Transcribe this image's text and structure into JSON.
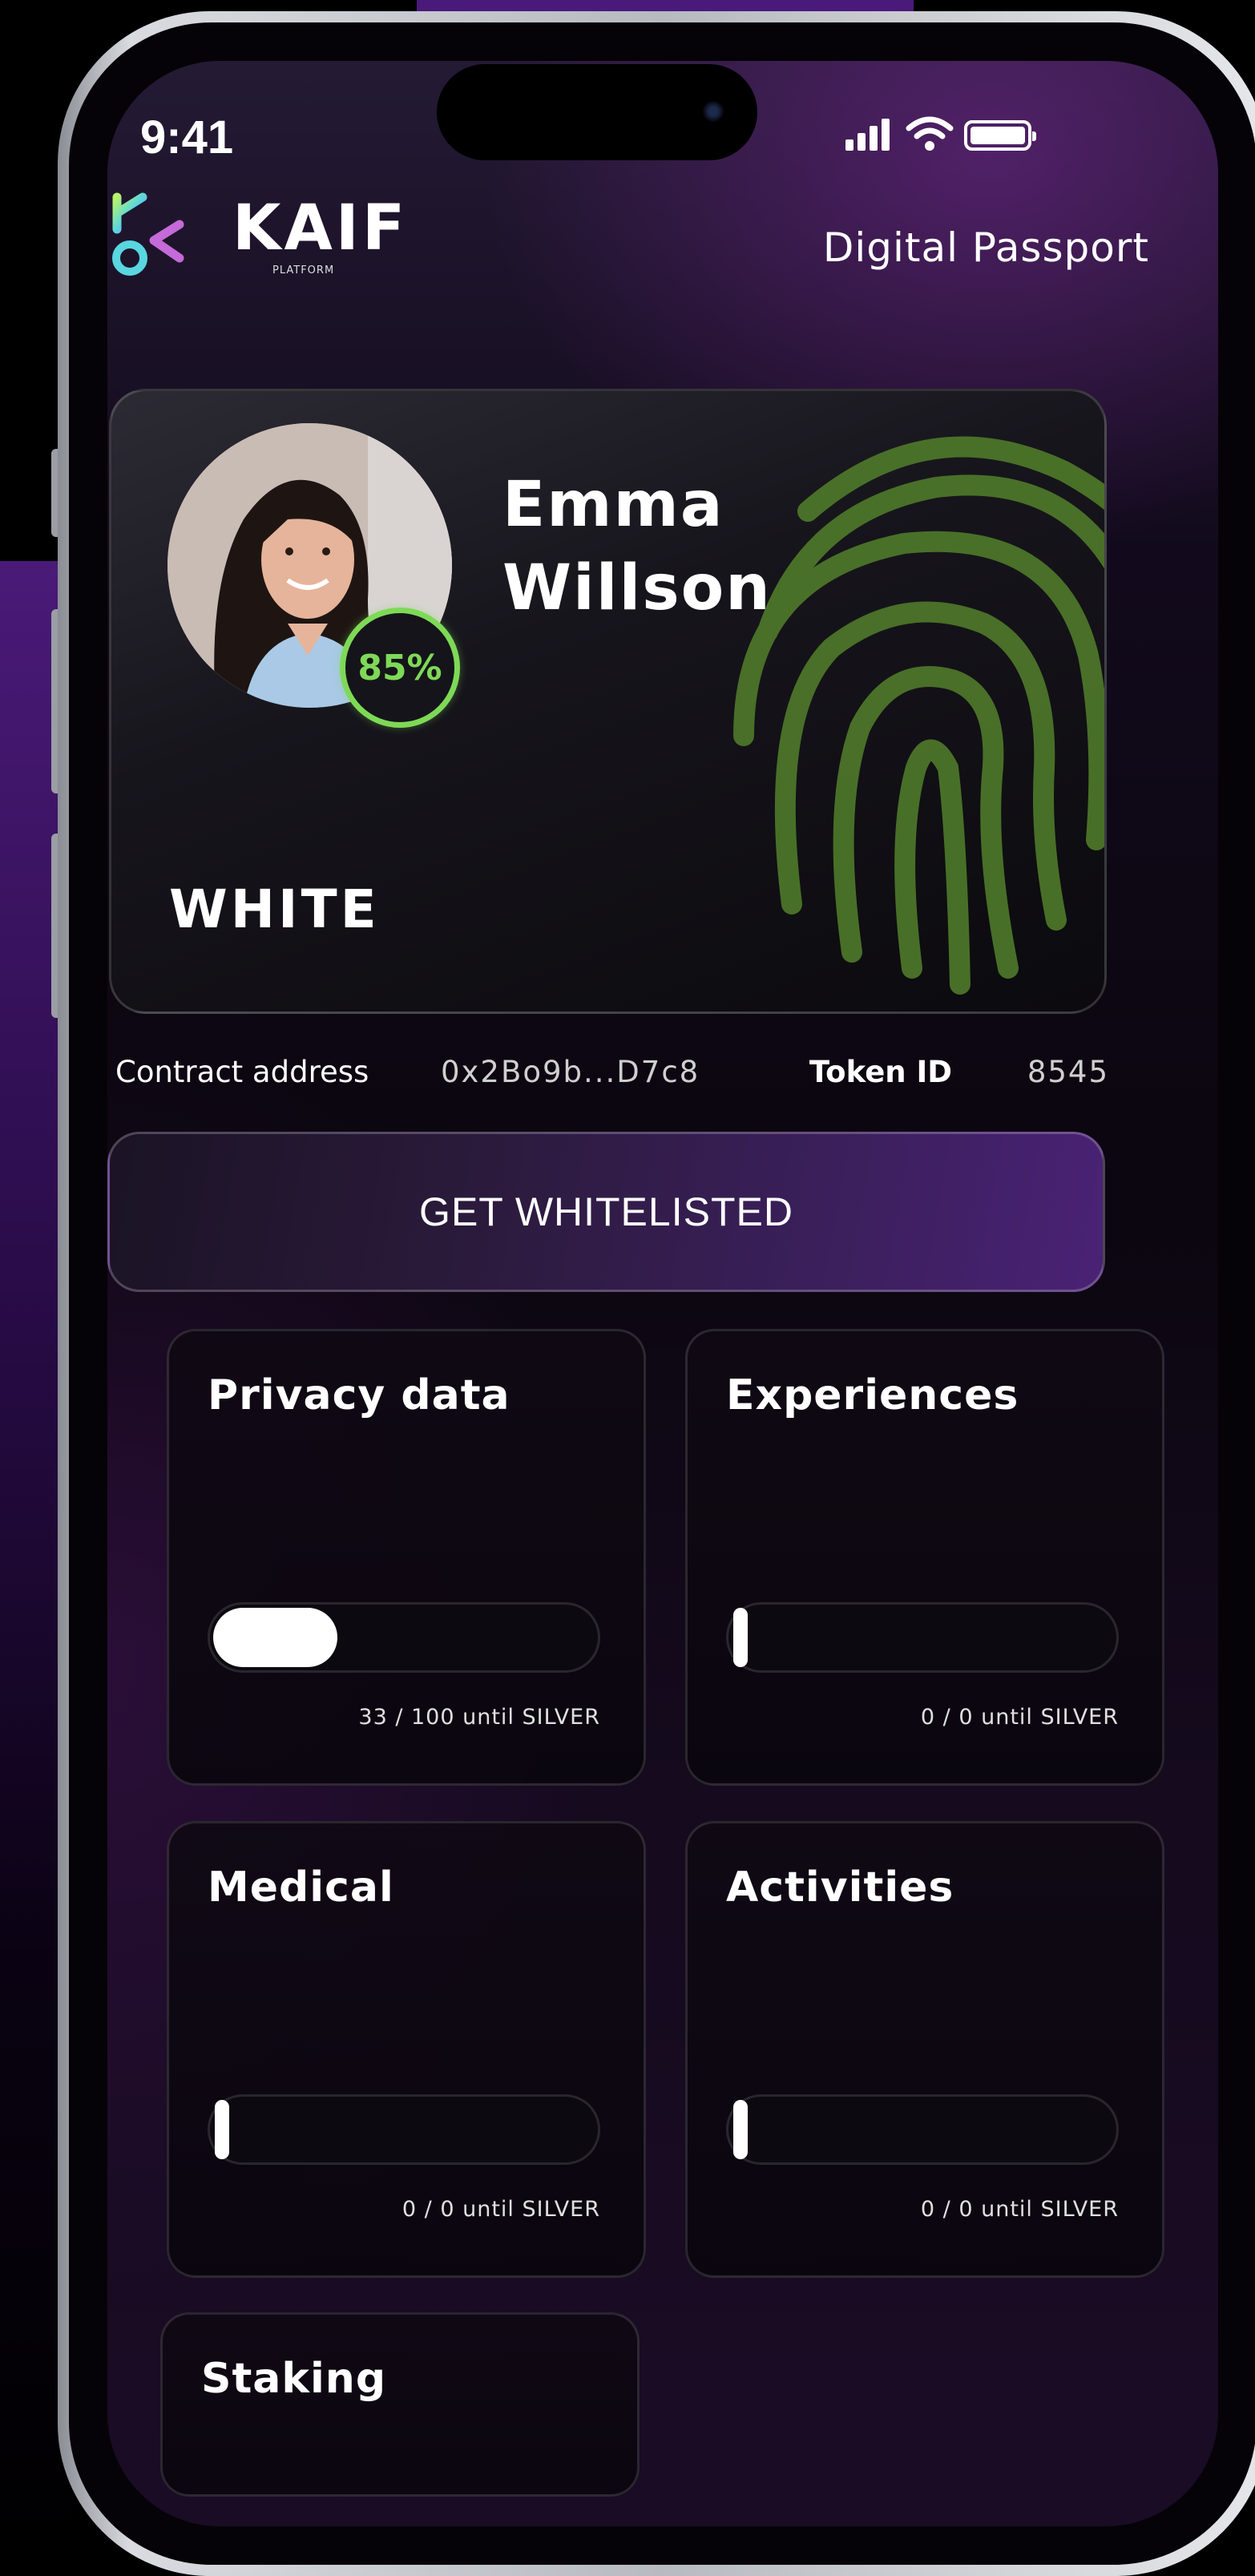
{
  "status_bar": {
    "time": "9:41"
  },
  "header": {
    "logo_text": "KAIF",
    "logo_sub": "PLATFORM",
    "title": "Digital Passport"
  },
  "passport": {
    "name_first": "Emma",
    "name_last": "Willson",
    "score": "85%",
    "score_value": 0.85,
    "tier": "WHITE",
    "contract_label": "Contract address",
    "contract_value": "0x2Bo9b...D7c8",
    "token_label": "Token ID",
    "token_value": "8545"
  },
  "cta": {
    "label": "GET WHITELISTED"
  },
  "tiles": [
    {
      "title": "Privacy data",
      "progress": 0.33,
      "status": "33 / 100 until SILVER"
    },
    {
      "title": "Experiences",
      "progress": 0,
      "status": "0 / 0 until SILVER"
    },
    {
      "title": "Medical",
      "progress": 0,
      "status": "0 / 0 until SILVER"
    },
    {
      "title": "Activities",
      "progress": 0,
      "status": "0 / 0 until SILVER"
    },
    {
      "title": "Staking"
    }
  ],
  "colors": {
    "accent_green": "#7ed957",
    "fingerprint": "#4f7a2a",
    "cta_purple": "#4a2275"
  },
  "icons": [
    "signal-icon",
    "wifi-icon",
    "battery-icon",
    "kaif-logo-icon",
    "fingerprint-icon"
  ]
}
